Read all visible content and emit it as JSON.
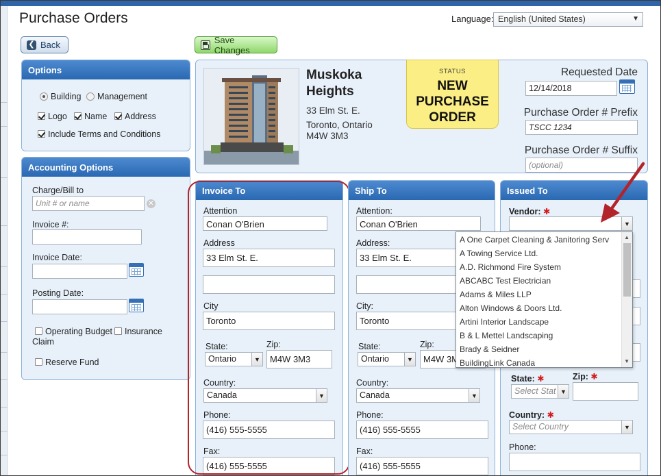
{
  "header": {
    "title": "Purchase Orders",
    "language_label": "Language:",
    "language_value": "English (United States)"
  },
  "toolbar": {
    "back_label": "Back",
    "save_label": "Save Changes"
  },
  "options": {
    "title": "Options",
    "building_label": "Building",
    "management_label": "Management",
    "logo_label": "Logo",
    "name_label": "Name",
    "address_label": "Address",
    "terms_label": "Include Terms and Conditions"
  },
  "accounting": {
    "title": "Accounting Options",
    "charge_label": "Charge/Bill to",
    "charge_placeholder": "Unit # or name",
    "invoice_num_label": "Invoice #:",
    "invoice_date_label": "Invoice Date:",
    "posting_date_label": "Posting Date:",
    "operating_budget_label": "Operating Budget",
    "insurance_label": "Insurance",
    "claim_label": "Claim",
    "reserve_fund_label": "Reserve Fund"
  },
  "building": {
    "name_line1": "Muskoka",
    "name_line2": "Heights",
    "address1": "33 Elm St. E.",
    "address2": "Toronto, Ontario",
    "address3": "M4W 3M3"
  },
  "status": {
    "label": "STATUS",
    "value": "NEW PURCHASE ORDER"
  },
  "po": {
    "requested_date_label": "Requested Date",
    "requested_date_value": "12/14/2018",
    "prefix_label": "Purchase Order # Prefix",
    "prefix_value": "TSCC 1234",
    "suffix_label": "Purchase Order # Suffix",
    "suffix_placeholder": "(optional)"
  },
  "invoice_to": {
    "title": "Invoice To",
    "attention_label": "Attention",
    "attention_value": "Conan  O'Brien",
    "address_label": "Address",
    "address_value": "33 Elm St. E.",
    "address2_value": "",
    "city_label": "City",
    "city_value": "Toronto",
    "state_label": "State:",
    "state_value": "Ontario",
    "zip_label": "Zip:",
    "zip_value": "M4W 3M3",
    "country_label": "Country:",
    "country_value": "Canada",
    "phone_label": "Phone:",
    "phone_value": "(416) 555-5555",
    "fax_label": "Fax:",
    "fax_value": "(416) 555-5555"
  },
  "ship_to": {
    "title": "Ship To",
    "attention_label": "Attention:",
    "attention_value": "Conan  O'Brien",
    "address_label": "Address:",
    "address_value": "33 Elm St. E.",
    "city_label": "City:",
    "city_value": "Toronto",
    "state_label": "State:",
    "state_value": "Ontario",
    "zip_label": "Zip:",
    "zip_value": "M4W 3M3",
    "country_label": "Country:",
    "country_value": "Canada",
    "phone_label": "Phone:",
    "phone_value": "(416) 555-5555",
    "fax_label": "Fax:",
    "fax_value": "(416) 555-5555"
  },
  "issued_to": {
    "title": "Issued To",
    "vendor_label": "Vendor:",
    "state_label": "State:",
    "state_placeholder": "Select Stat",
    "zip_label": "Zip:",
    "country_label": "Country:",
    "country_placeholder": "Select Country",
    "phone_label": "Phone:"
  },
  "vendor_options": [
    "A One Carpet Cleaning & Janitoring Serv",
    "A Towing Service Ltd.",
    "A.D. Richmond Fire System",
    "ABCABC Test Electrician",
    "Adams & Miles LLP",
    "Alton Windows & Doors Ltd.",
    "Artini Interior Landscape",
    "B & L Mettel Landscaping",
    "Brady & Seidner",
    "BuildingLink Canada"
  ],
  "colors": {
    "panel_header": "#2a68b2",
    "status_bg": "#fbee84",
    "highlight_circle": "#b3232a",
    "arrow": "#b3232a",
    "save_button": "#8fd86b"
  }
}
